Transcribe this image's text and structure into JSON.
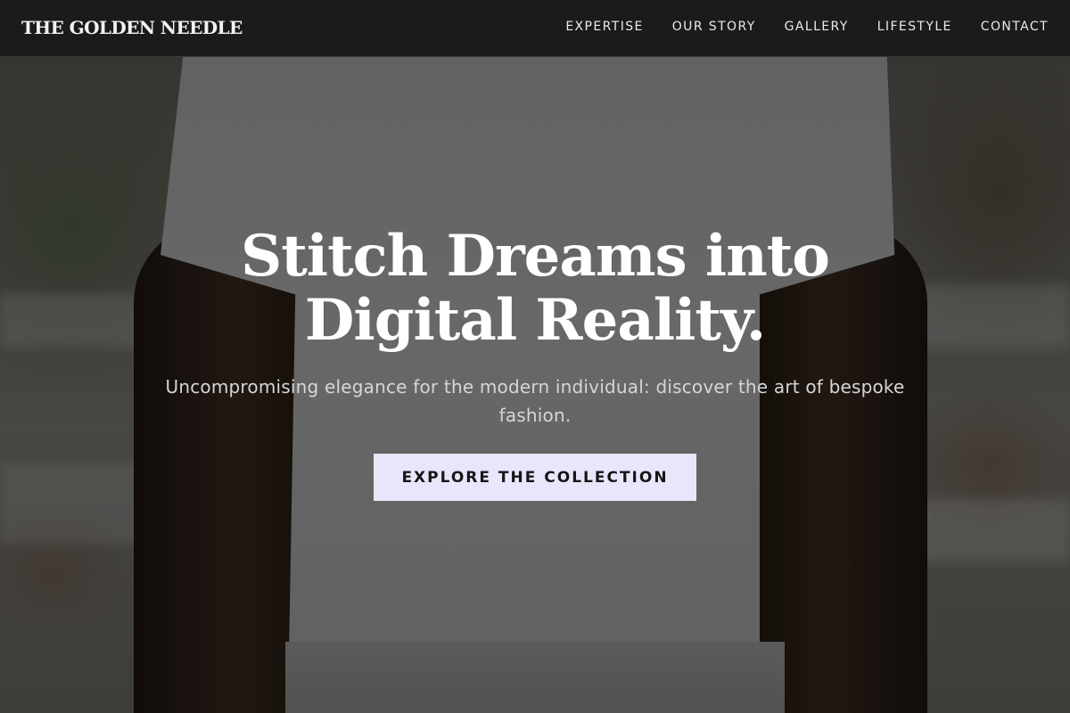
{
  "brand": {
    "name": "THE GOLDEN NEEDLE"
  },
  "nav": {
    "items": [
      {
        "label": "EXPERTISE"
      },
      {
        "label": "OUR STORY"
      },
      {
        "label": "GALLERY"
      },
      {
        "label": "LIFESTYLE"
      },
      {
        "label": "CONTACT"
      }
    ]
  },
  "hero": {
    "title_line1": "Stitch Dreams into",
    "title_line2": "Digital Reality.",
    "subtitle": "Uncompromising elegance for the modern individual: discover the art of bespoke fashion.",
    "cta_label": "EXPLORE THE COLLECTION"
  },
  "colors": {
    "navbar_bg": "#1b1b1b",
    "cta_bg": "#e9e6fb",
    "text_primary": "#ffffff"
  }
}
